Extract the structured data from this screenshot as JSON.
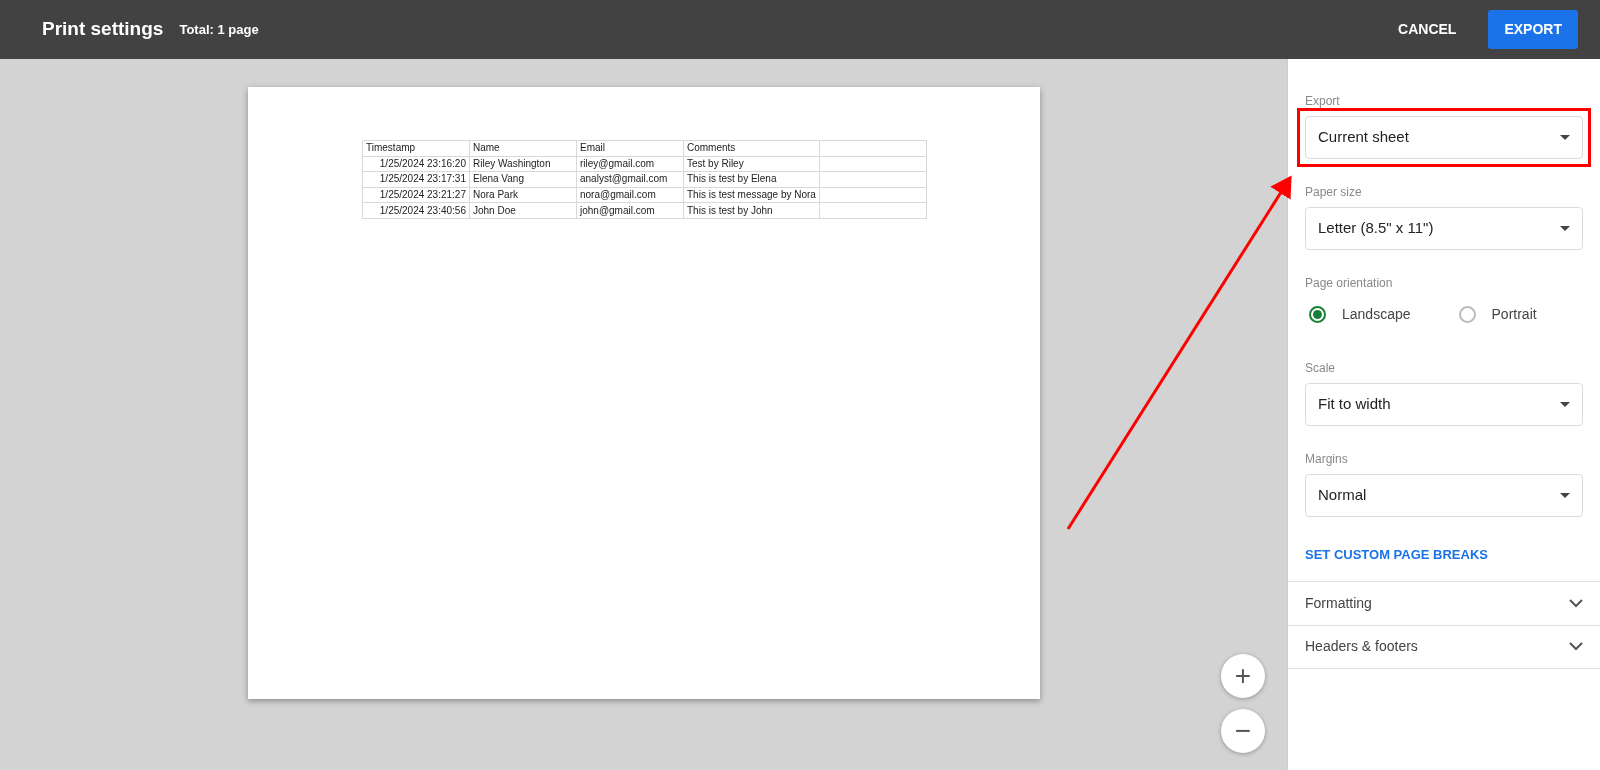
{
  "header": {
    "title": "Print settings",
    "subtitle": "Total: 1 page",
    "buttons": [
      {
        "label": "CANCEL",
        "kind": "text"
      },
      {
        "label": "EXPORT",
        "kind": "primary"
      }
    ]
  },
  "preview": {
    "table": {
      "columns": [
        "Timestamp",
        "Name",
        "Email",
        "Comments"
      ],
      "rows": [
        [
          "1/25/2024 23:16:20",
          "Riley Washington",
          "riley@gmail.com",
          "Test by Riley"
        ],
        [
          "1/25/2024 23:17:31",
          "Elena Vang",
          "analyst@gmail.com",
          "This is test by Elena"
        ],
        [
          "1/25/2024 23:21:27",
          "Nora Park",
          "nora@gmail.com",
          "This is test message by Nora"
        ],
        [
          "1/25/2024 23:40:56",
          "John Doe",
          "john@gmail.com",
          "This is test by John"
        ]
      ]
    },
    "zoom_buttons": [
      {
        "label": "+"
      },
      {
        "label": "−"
      }
    ]
  },
  "settings": [
    {
      "kind": "select",
      "label": "Export",
      "value": "Current sheet",
      "highlighted": true
    },
    {
      "kind": "select",
      "label": "Paper size",
      "value": "Letter (8.5\" x 11\")"
    },
    {
      "kind": "radio",
      "label": "Page orientation",
      "options": [
        {
          "label": "Landscape",
          "selected": true
        },
        {
          "label": "Portrait",
          "selected": false
        }
      ]
    },
    {
      "kind": "select",
      "label": "Scale",
      "value": "Fit to width"
    },
    {
      "kind": "select",
      "label": "Margins",
      "value": "Normal"
    },
    {
      "kind": "link",
      "label": "SET CUSTOM PAGE BREAKS"
    }
  ],
  "sections": [
    {
      "label": "Formatting",
      "expanded": false
    },
    {
      "label": "Headers & footers",
      "expanded": false
    }
  ]
}
